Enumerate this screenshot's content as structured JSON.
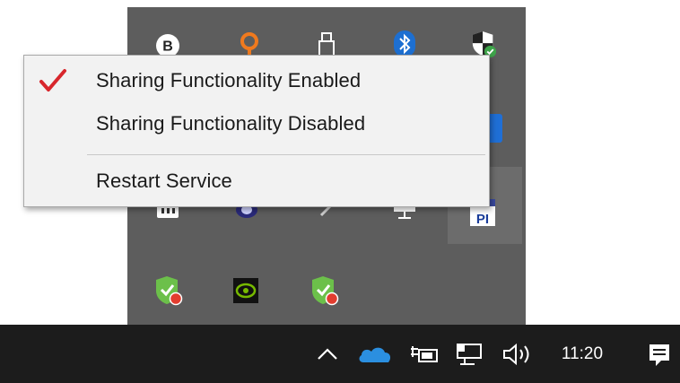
{
  "context_menu": {
    "items": [
      {
        "label": "Sharing Functionality Enabled",
        "checked": true
      },
      {
        "label": "Sharing Functionality Disabled",
        "checked": false
      },
      {
        "label": "Restart Service",
        "checked": false
      }
    ]
  },
  "tray_flyout": {
    "icon_letter_b": "B",
    "icon_pi": "PI"
  },
  "taskbar": {
    "time": "11:20"
  },
  "colors": {
    "flyout_bg": "#5d5d5d",
    "taskbar_bg": "#1c1c1c",
    "checkmark": "#d8262c",
    "onedrive": "#2b8fe0",
    "shield_green": "#3ea34a"
  }
}
